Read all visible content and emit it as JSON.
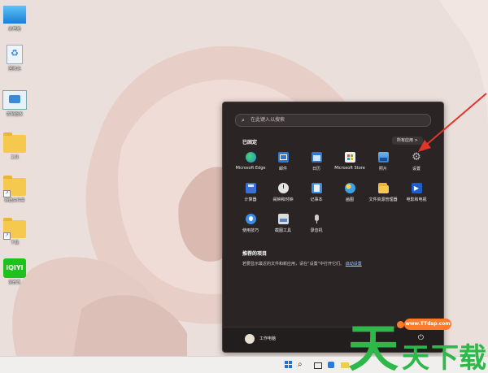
{
  "desktop": {
    "icons": [
      {
        "label": "此电脑",
        "kind": "monitor"
      },
      {
        "label": "回收站",
        "kind": "recycle"
      },
      {
        "label": "控制面板",
        "kind": "control"
      },
      {
        "label": "工具",
        "kind": "folder"
      },
      {
        "label": "新建文件夹",
        "kind": "folder-shortcut"
      },
      {
        "label": "下载",
        "kind": "folder-shortcut"
      },
      {
        "label": "爱奇艺",
        "kind": "iqiyi"
      }
    ]
  },
  "start_menu": {
    "search_placeholder": "在此键入以搜索",
    "pinned_title": "已固定",
    "all_apps_label": "所有应用  >",
    "apps": [
      {
        "label": "Microsoft Edge",
        "icon": "edge-icon",
        "color": "#1fa3d6"
      },
      {
        "label": "邮件",
        "icon": "mail-icon",
        "color": "#2b7bd6"
      },
      {
        "label": "日历",
        "icon": "calendar-icon",
        "color": "#2b7bd6"
      },
      {
        "label": "Microsoft Store",
        "icon": "store-icon",
        "color": "#f0f0f0"
      },
      {
        "label": "照片",
        "icon": "photos-icon",
        "color": "#3f8fe0"
      },
      {
        "label": "设置",
        "icon": "gear-icon",
        "color": "#8a8a8a"
      },
      {
        "label": "计算器",
        "icon": "calculator-icon",
        "color": "#3b6fd1"
      },
      {
        "label": "闹钟和时钟",
        "icon": "clock-icon",
        "color": "#e4e4e4"
      },
      {
        "label": "记事本",
        "icon": "notepad-icon",
        "color": "#3a8ee6"
      },
      {
        "label": "画图",
        "icon": "paint-icon",
        "color": "#3aa0e8"
      },
      {
        "label": "文件资源管理器",
        "icon": "folder-icon",
        "color": "#f4c94d"
      },
      {
        "label": "电影和电视",
        "icon": "movies-icon",
        "color": "#1f5ec9"
      },
      {
        "label": "使用技巧",
        "icon": "tips-icon",
        "color": "#3a8ee6"
      },
      {
        "label": "截图工具",
        "icon": "snip-icon",
        "color": "#dcdcdc"
      },
      {
        "label": "录音机",
        "icon": "recorder-icon",
        "color": "#cfcfcf"
      }
    ],
    "recommended_title": "推荐的项目",
    "recommended_text": "若要显示最近的文件和新应用，请在“设置”中打开它们。",
    "recommended_link": "启动设置",
    "user_name": "工作电脑"
  },
  "taskbar": {
    "items": [
      "windows-start-icon",
      "search-icon",
      "task-view-icon",
      "widgets-icon",
      "file-explorer-icon",
      "edge-icon"
    ]
  },
  "watermark": {
    "url": "www.TTdsp.com",
    "brand": "天天下载"
  },
  "colors": {
    "accent_arrow": "#e0362a",
    "menu_bg": "#2a2424",
    "watermark": "#2fb84a"
  }
}
